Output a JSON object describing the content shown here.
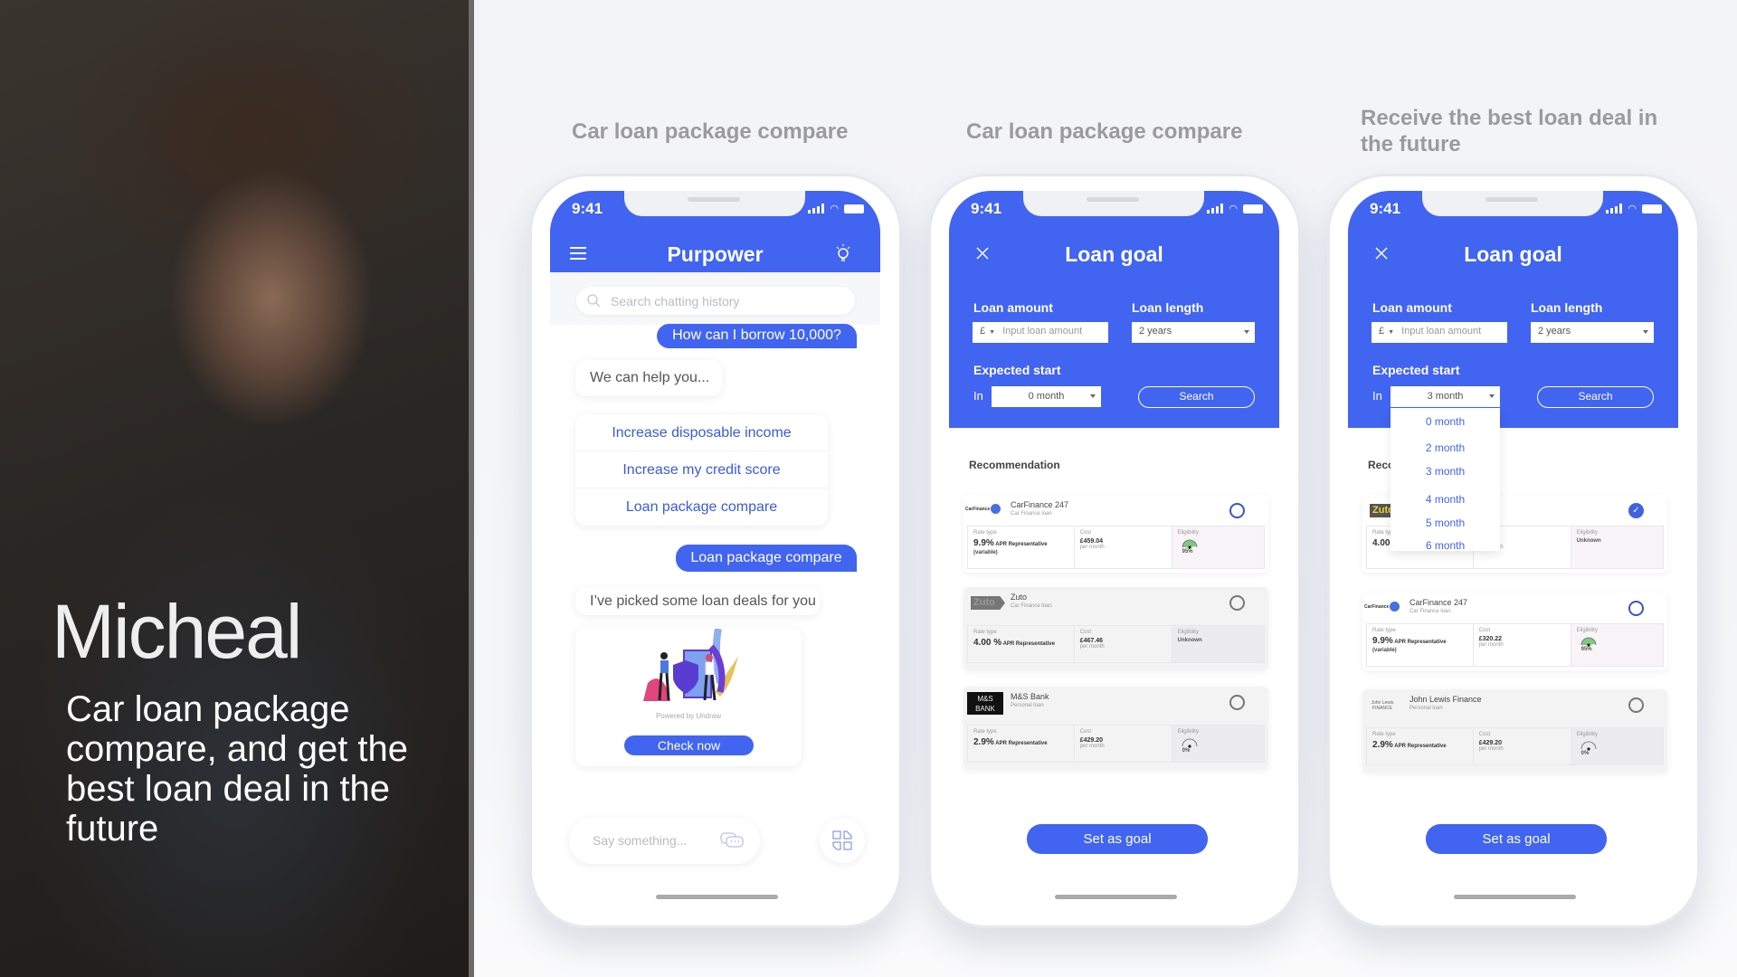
{
  "hero": {
    "name": "Micheal",
    "description": "Car loan package compare, and get the best loan deal in the future"
  },
  "columns": [
    {
      "title": "Car loan package compare"
    },
    {
      "title": "Car loan package compare"
    },
    {
      "title": "Receive the best loan deal in the future"
    }
  ],
  "colors": {
    "accent": "#4164f1",
    "option_text": "#3a5bd9",
    "gauge_green": "#6bbf6b"
  },
  "status": {
    "time": "9:41"
  },
  "chat": {
    "app_title": "Purpower",
    "menu_icon": "hamburger-icon",
    "bulb_icon": "lightbulb-icon",
    "search_placeholder": "Search chatting history",
    "user_msg_1": "How can I borrow 10,000?",
    "bot_msg_1": "We can help you...",
    "options": [
      "Increase disposable income",
      "Increase my credit score",
      "Loan package compare"
    ],
    "user_msg_2": "Loan package compare",
    "bot_msg_2": "I’ve picked some loan deals for you",
    "illustration_caption": "Powered by Undraw",
    "check_button": "Check now",
    "input_placeholder": "Say something...",
    "chat_icon": "chat-bubbles-icon",
    "grid_icon": "grid-icon"
  },
  "goal": {
    "title": "Loan goal",
    "loan_amount_label": "Loan amount",
    "currency": "£",
    "amount_placeholder": "Input loan amount",
    "loan_length_label": "Loan length",
    "loan_length_value": "2 years",
    "expected_start_label": "Expected start",
    "in_label": "In",
    "search_button": "Search",
    "recommendation_label": "Recommendation",
    "set_goal_button": "Set as goal",
    "rate_label": "Rate type",
    "cost_label": "Cost",
    "eligibility_label": "Eligibility",
    "per_month": "per month"
  },
  "screen2": {
    "start_value": "0 month",
    "cards": [
      {
        "logo": "CarFinance 247",
        "name": "CarFinance 247",
        "type": "Car Finance loan",
        "rate": "9.9%",
        "apr": "APR Representative",
        "variable": "(variable)",
        "cost": "£459.04",
        "eligibility": "95%",
        "gauge": 0.95,
        "selected": false,
        "muted": false
      },
      {
        "logo": "Zuto",
        "name": "Zuto",
        "type": "Car Finance loan",
        "rate": "4.00 %",
        "apr": "APR Representative",
        "variable": "",
        "cost": "£467.46",
        "eligibility": "Unknown",
        "gauge": null,
        "selected": false,
        "muted": true
      },
      {
        "logo": "M&S BANK",
        "name": "M&S Bank",
        "type": "Personal loan",
        "rate": "2.9%",
        "apr": "APR Representative",
        "variable": "",
        "cost": "£429.20",
        "eligibility": "0%",
        "gauge": 0,
        "selected": false,
        "muted": true
      }
    ]
  },
  "screen3": {
    "start_value": "3 month",
    "recommendation_partial": "Reco",
    "dropdown_options": [
      "0 month",
      "2 month",
      "3 month",
      "4 month",
      "5 month",
      "6 month"
    ],
    "cards": [
      {
        "logo": "Zuto",
        "name": "",
        "type": "",
        "rate": "4.00",
        "apr": "",
        "variable": "",
        "cost": "9",
        "eligibility": "Unknown",
        "gauge": null,
        "selected": true,
        "muted": false
      },
      {
        "logo": "CarFinance 247",
        "name": "CarFinance 247",
        "type": "Car Finance loan",
        "rate": "9.9%",
        "apr": "APR Representative",
        "variable": "(variable)",
        "cost": "£320.22",
        "eligibility": "95%",
        "gauge": 0.95,
        "selected": false,
        "muted": false
      },
      {
        "logo": "John Lewis FINANCE",
        "name": "John Lewis Finance",
        "type": "Personal loan",
        "rate": "2.9%",
        "apr": "APR Representative",
        "variable": "",
        "cost": "£429.20",
        "eligibility": "0%",
        "gauge": 0,
        "selected": false,
        "muted": true
      }
    ]
  }
}
